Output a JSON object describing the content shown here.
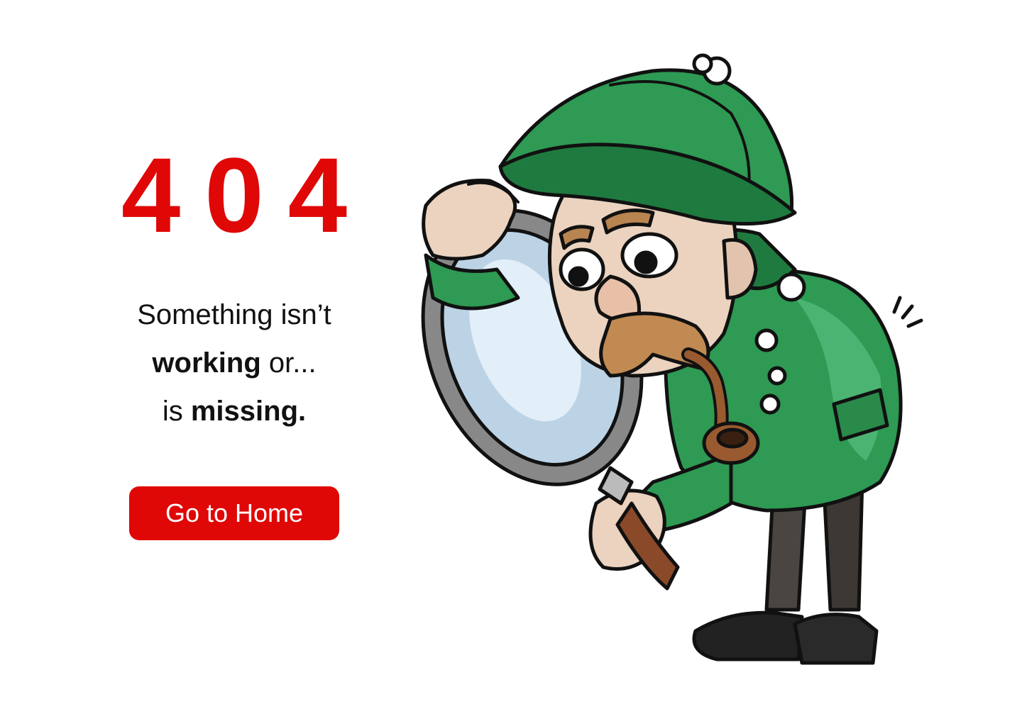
{
  "error": {
    "code": "404"
  },
  "message": {
    "line1": "Something isn’t",
    "line2_bold": "working",
    "line2_rest": " or...",
    "line3_pre": "is ",
    "line3_bold": "missing."
  },
  "actions": {
    "home_label": "Go to Home"
  },
  "colors": {
    "accent": "#e00707",
    "background": "#ffffff",
    "text": "#111111",
    "coat": "#2e9a53"
  },
  "illustration": {
    "icon": "detective-magnifier-icon"
  }
}
